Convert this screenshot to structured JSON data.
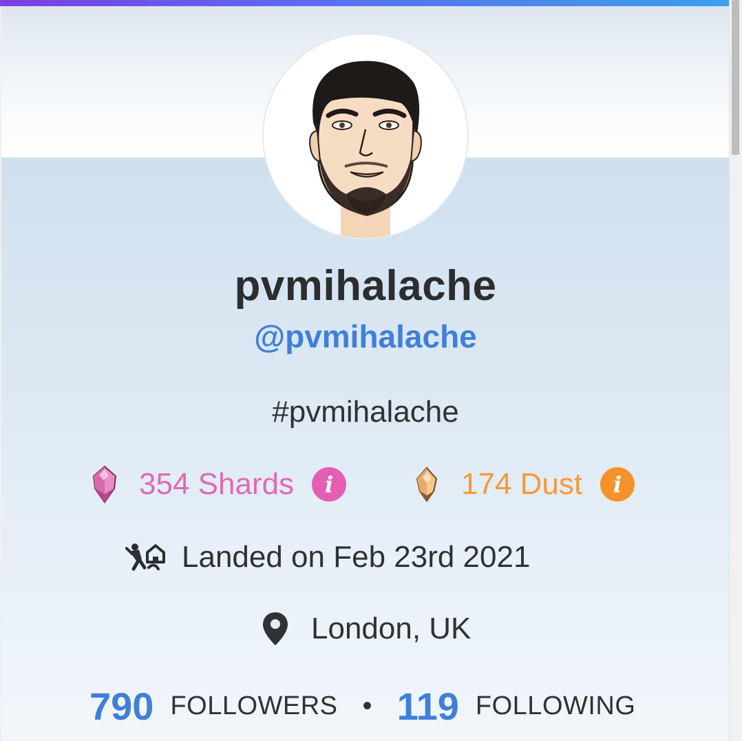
{
  "colors": {
    "accent_blue": "#3f7fd8",
    "shards_pink": "#e06ab4",
    "dust_orange": "#f59a3a",
    "text_dark": "#2b2d30"
  },
  "profile": {
    "display_name": "pvmihalache",
    "handle": "@pvmihalache",
    "hashtag": "#pvmihalache",
    "avatar_icon": "avatar-illustration"
  },
  "stats": {
    "shards_label": "354 Shards",
    "shards_icon": "pink-gem-icon",
    "dust_label": "174 Dust",
    "dust_icon": "amber-gem-icon",
    "info_glyph": "i"
  },
  "details": {
    "landed_text": "Landed on Feb 23rd 2021",
    "landed_icon": "parachute-landing-icon",
    "location_text": "London, UK",
    "location_icon": "map-pin-icon"
  },
  "social": {
    "followers_count": "790",
    "followers_label": "FOLLOWERS",
    "separator": "•",
    "following_count": "119",
    "following_label": "FOLLOWING"
  }
}
